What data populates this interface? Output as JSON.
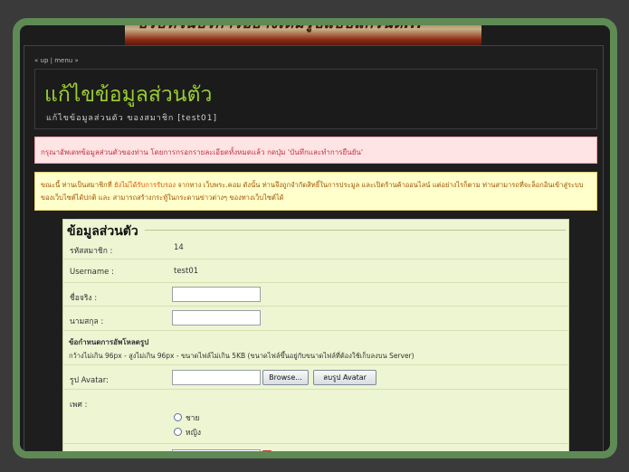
{
  "banner": {
    "text": "บริษัทในบริการอย่างเต็มรูปแบบแกรนด์..."
  },
  "topnav": {
    "up": "« up",
    "separator": "|",
    "menu": "menu »"
  },
  "header": {
    "title": "แก้ไขข้อมูลส่วนตัว",
    "subtitle": "แก้ไขข้อมูลส่วนตัว ของสมาชิก [test01]"
  },
  "notices": {
    "error": "กรุณาอัพเดทข้อมูลส่วนตัวของท่าน โดยการกรอกรายละเอียดทั้งหมดแล้ว กดปุ่ม 'บันทึกและทำการยืนยัน'",
    "warn_before": "ขณะนี้ ท่านเป็นสมาชิกที่ ",
    "warn_highlight": "ยังไม่ได้รับการรับรอง",
    "warn_after": " จากทาง เว็บพระ.คอม ดังนั้น ท่านจึงถูกจำกัดสิทธิ์ในการประมูล และเปิดร้านค้าออนไลน์ แต่อย่างไรก็ตาม ท่านสามารถที่จะล็อกอินเข้าสู่ระบบของเว็บไซต์ได้ปกติ และ สามารถสร้างกระทู้ในกระดานข่าวต่างๆ ของทางเว็บไซต์ได้"
  },
  "form": {
    "legend": "ข้อมูลส่วนตัว",
    "member_id_label": "รหัสสมาชิก :",
    "member_id_value": "14",
    "username_label": "Username :",
    "username_value": "test01",
    "firstname_label": "ชื่อจริง :",
    "firstname_value": "",
    "lastname_label": "นามสกุล :",
    "lastname_value": "",
    "upload_title": "ข้อกำหนดการอัพโหลดรูป",
    "upload_hint": "กว้างไม่เกิน 96px - สูงไม่เกิน 96px - ขนาดไฟล์ไม่เกิน 5KB (ขนาดไฟล์ขึ้นอยู่กับขนาดไฟล์ที่ต้องใช้เก็บลงบน Server)",
    "avatar_label": "รูป Avatar:",
    "browse_label": "Browse...",
    "delete_avatar_label": "ลบรูป Avatar",
    "gender_label": "เพศ :",
    "gender_options": [
      "ชาย",
      "หญิง"
    ]
  }
}
